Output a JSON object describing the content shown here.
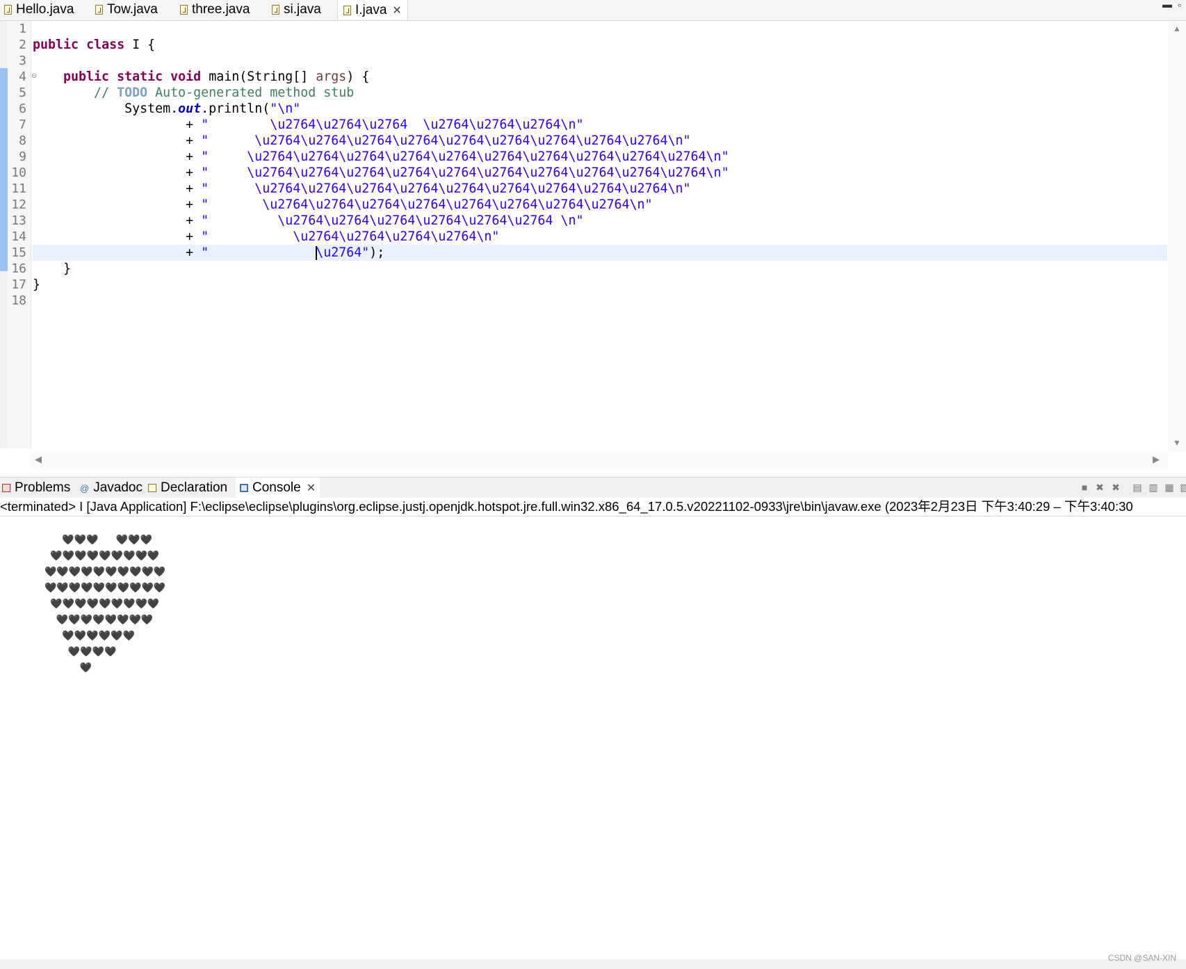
{
  "editor_tabs": [
    {
      "label": "Hello.java"
    },
    {
      "label": "Tow.java"
    },
    {
      "label": "three.java"
    },
    {
      "label": "si.java"
    },
    {
      "label": "I.java",
      "active": true,
      "close": "✕"
    }
  ],
  "window_buttons": {
    "minimize": "▬",
    "maximize": "▫"
  },
  "line_numbers": [
    "1",
    "2",
    "3",
    "4",
    "5",
    "6",
    "7",
    "8",
    "9",
    "10",
    "11",
    "12",
    "13",
    "14",
    "15",
    "16",
    "17",
    "18"
  ],
  "code": {
    "l2_kw1": "public",
    "l2_kw2": "class",
    "l2_rest": " I {",
    "l4_kw1": "public",
    "l4_kw2": "static",
    "l4_kw3": "void",
    "l4_method": " main(String[] ",
    "l4_param": "args",
    "l4_end": ") {",
    "l5_slashes": "// ",
    "l5_todo": "TODO",
    "l5_comment": " Auto-generated method stub",
    "l6_prefix": "System.",
    "l6_field": "out",
    "l6_call": ".println(",
    "l6_string": "\"\\n\"",
    "concat_prefix": "+ ",
    "l7_string": "\"        \\u2764\\u2764\\u2764  \\u2764\\u2764\\u2764\\n\"",
    "l8_string": "\"      \\u2764\\u2764\\u2764\\u2764\\u2764\\u2764\\u2764\\u2764\\u2764\\n\"",
    "l9_string": "\"     \\u2764\\u2764\\u2764\\u2764\\u2764\\u2764\\u2764\\u2764\\u2764\\u2764\\n\"",
    "l10_string": "\"     \\u2764\\u2764\\u2764\\u2764\\u2764\\u2764\\u2764\\u2764\\u2764\\u2764\\n\"",
    "l11_string": "\"      \\u2764\\u2764\\u2764\\u2764\\u2764\\u2764\\u2764\\u2764\\u2764\\n\"",
    "l12_string": "\"       \\u2764\\u2764\\u2764\\u2764\\u2764\\u2764\\u2764\\u2764\\n\"",
    "l13_string": "\"         \\u2764\\u2764\\u2764\\u2764\\u2764\\u2764 \\n\"",
    "l14_string": "\"           \\u2764\\u2764\\u2764\\u2764\\n\"",
    "l15_string_a": "\"              ",
    "l15_string_b": "\\u2764\"",
    "l15_end": ");",
    "l16": "}",
    "l17": "}"
  },
  "view_tabs": [
    {
      "label": "Problems"
    },
    {
      "label": "Javadoc"
    },
    {
      "label": "Declaration"
    },
    {
      "label": "Console",
      "active": true,
      "close": "✕"
    }
  ],
  "console_status": "<terminated> I [Java Application] F:\\eclipse\\eclipse\\plugins\\org.eclipse.justj.openjdk.hotspot.jre.full.win32.x86_64_17.0.5.v20221102-0933\\jre\\bin\\javaw.exe  (2023年2月23日 下午3:40:29 – 下午3:40:30",
  "console_output_rows": [
    "   🖤🖤🖤   🖤🖤🖤",
    " 🖤🖤🖤🖤🖤🖤🖤🖤🖤",
    "🖤🖤🖤🖤🖤🖤🖤🖤🖤🖤",
    "🖤🖤🖤🖤🖤🖤🖤🖤🖤🖤",
    " 🖤🖤🖤🖤🖤🖤🖤🖤🖤",
    "  🖤🖤🖤🖤🖤🖤🖤🖤",
    "   🖤🖤🖤🖤🖤🖤",
    "    🖤🖤🖤🖤",
    "      🖤"
  ],
  "watermark": "CSDN @SAN-XIN"
}
